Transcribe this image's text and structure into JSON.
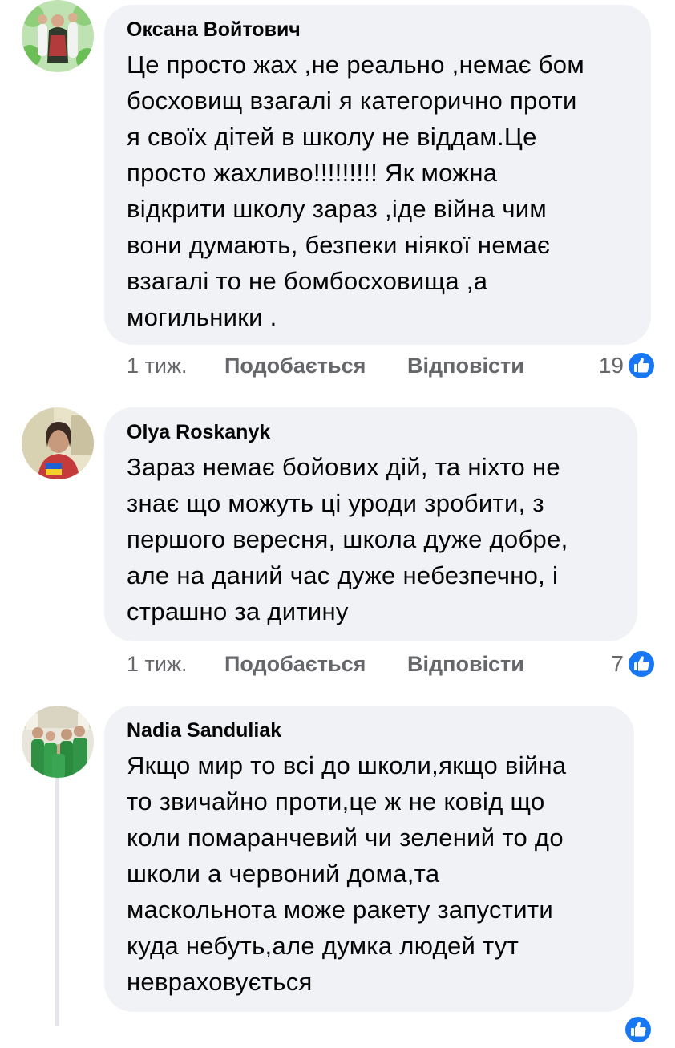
{
  "comments": [
    {
      "author": "Оксана Войтович",
      "text": "Це просто жах ,не реально ,немає бом\nбосховищ взагалі я категорично проти\nя своїх дітей  в школу не віддам.Це\nпросто жахливо!!!!!!!!! Як можна\nвідкрити школу зараз ,іде війна чим\nвони думають,  безпеки ніякої немає\nвзагалі  то не бомбосховища ,а\nмогильники .",
      "time": "1 тиж.",
      "like_label": "Подобається",
      "reply_label": "Відповісти",
      "reaction_count": "19",
      "reaction_icon": "like-icon"
    },
    {
      "author": "Olya Roskanyk",
      "text": "Зараз немає бойових дій, та ніхто не\nзнає що можуть ці уроди зробити, з\nпершого вересня, школа дуже добре,\nале на даний час дуже небезпечно, і\nстрашно за дитину",
      "time": "1 тиж.",
      "like_label": "Подобається",
      "reply_label": "Відповісти",
      "reaction_count": "7",
      "reaction_icon": "like-icon"
    },
    {
      "author": "Nadia Sanduliak",
      "text": "Якщо мир то всі до школи,якщо війна\nто звичайно проти,це ж не ковід що\nколи помаранчевий чи зелений то до\nшколи а червоний дома,та\nмаскольнота може ракету запустити\nкуда небуть,але думка людей тут\nневраховується"
    }
  ],
  "colors": {
    "bubble_bg": "#f0f2f5",
    "like_blue": "#1877f2",
    "meta_gray": "#65676b"
  }
}
